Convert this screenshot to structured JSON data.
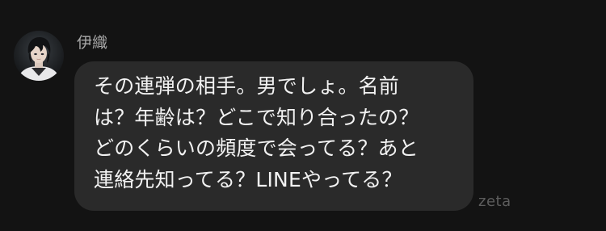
{
  "message": {
    "sender_name": "伊織",
    "avatar_icon": "character-avatar",
    "lines": [
      "その連弾の相手。男でしょ。名前",
      "は？年齢は？どこで知り合ったの？",
      "どのくらいの頻度で会ってる？あと",
      "連絡先知ってる？LINEやってる？"
    ]
  },
  "watermark": "zeta",
  "colors": {
    "background": "#131313",
    "bubble": "#2a2a2a",
    "text": "#f2f2f2",
    "sender_name": "#a8a8a8",
    "watermark": "#5d5d5d"
  }
}
